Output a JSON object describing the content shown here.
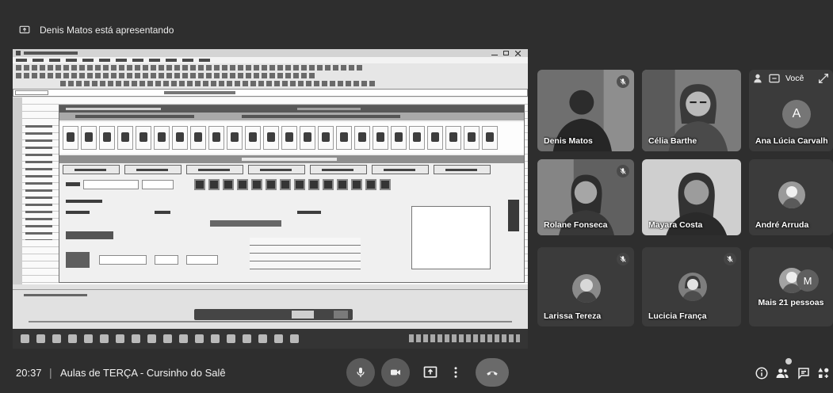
{
  "presentation": {
    "banner_text": "Denis Matos está apresentando",
    "banner_icon": "present-screen-icon"
  },
  "self_view": {
    "label": "Você"
  },
  "participants": [
    {
      "name": "Denis Matos"
    },
    {
      "name": "Célia Barthe"
    },
    {
      "name": "Ana Lúcia Carvalho",
      "initial": "A"
    },
    {
      "name": "Rolane Fonseca"
    },
    {
      "name": "Mayara Costa"
    },
    {
      "name": "André Arruda"
    },
    {
      "name": "Larissa Tereza"
    },
    {
      "name": "Lucicia França"
    }
  ],
  "others_tile": {
    "initial": "M",
    "label": "Mais 21 pessoas"
  },
  "meeting": {
    "time": "20:37",
    "separator": "|",
    "title": "Aulas de TERÇA - Cursinho do Salê"
  },
  "controls": {
    "center": [
      "mic-icon",
      "camera-icon",
      "present-now-icon",
      "more-options-icon",
      "end-call-icon"
    ],
    "right": [
      "info-icon",
      "people-icon",
      "chat-icon",
      "activities-icon"
    ]
  },
  "colors": {
    "background": "#2e2e2e",
    "tile": "#3b3b3b",
    "control_button": "#5a5a5a"
  }
}
